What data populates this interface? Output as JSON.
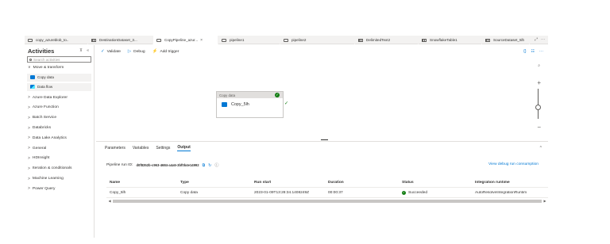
{
  "tabs": [
    {
      "label": "copy_azureblob_to..",
      "icon": "pipeline-icon",
      "active": false
    },
    {
      "label": "DestinationDataset_3...",
      "icon": "dataset-table-icon",
      "active": false
    },
    {
      "label": "CopyPipeline_azur...",
      "icon": "pipeline-icon",
      "active": true,
      "close": "×"
    },
    {
      "label": "pipeline1",
      "icon": "pipeline-icon",
      "active": false
    },
    {
      "label": "pipeline2",
      "icon": "pipeline-icon",
      "active": false
    },
    {
      "label": "DelimitedText2",
      "icon": "dataset-table-icon",
      "active": false
    },
    {
      "label": "SnowflakeTable1",
      "icon": "dataset-table-icon",
      "active": false
    },
    {
      "label": "SourceDataset_5lh",
      "icon": "dataset-table-icon",
      "active": false
    }
  ],
  "tabstrip_right": {
    "expand": "⤢",
    "more": "···"
  },
  "activities": {
    "title": "Activities",
    "head_icons": "⊼ «",
    "search_placeholder": "Search activities",
    "expanded_category": "Move & transform",
    "items": [
      "Copy data",
      "Data flow"
    ],
    "categories": [
      "Azure Data Explorer",
      "Azure Function",
      "Batch Service",
      "Databricks",
      "Data Lake Analytics",
      "General",
      "HDInsight",
      "Iteration & conditionals",
      "Machine Learning",
      "Power Query"
    ]
  },
  "toolbar": {
    "validate": "Validate",
    "debug": "Debug",
    "add_trigger": "Add trigger",
    "right_code": "{}",
    "right_props": "☷",
    "right_more": "···"
  },
  "canvas": {
    "node_type": "Copy data",
    "node_name": "Copy_5lh",
    "zoom_plus": "+",
    "zoom_minus": "−"
  },
  "bottom_tabs": [
    "Parameters",
    "Variables",
    "Settings",
    "Output"
  ],
  "bottom_active_tab": "Output",
  "output": {
    "run_id_label": "Pipeline run ID:",
    "run_id": "d0f8352b-c963-4684-a4a5-3bf0b4e14992",
    "consumption_link": "View debug run consumption",
    "columns": [
      "Name",
      "Type",
      "Run start",
      "Duration",
      "Status",
      "Integration runtime"
    ],
    "rows": [
      {
        "name": "Copy_5lh",
        "type": "Copy data",
        "run_start": "2023-01-09T13:28:34.1408249Z",
        "duration": "00:00:37",
        "status": "Succeeded",
        "runtime": "AutoResolveIntegrationRuntim"
      }
    ]
  },
  "colors": {
    "accent": "#0078d4",
    "success": "#107c10"
  }
}
